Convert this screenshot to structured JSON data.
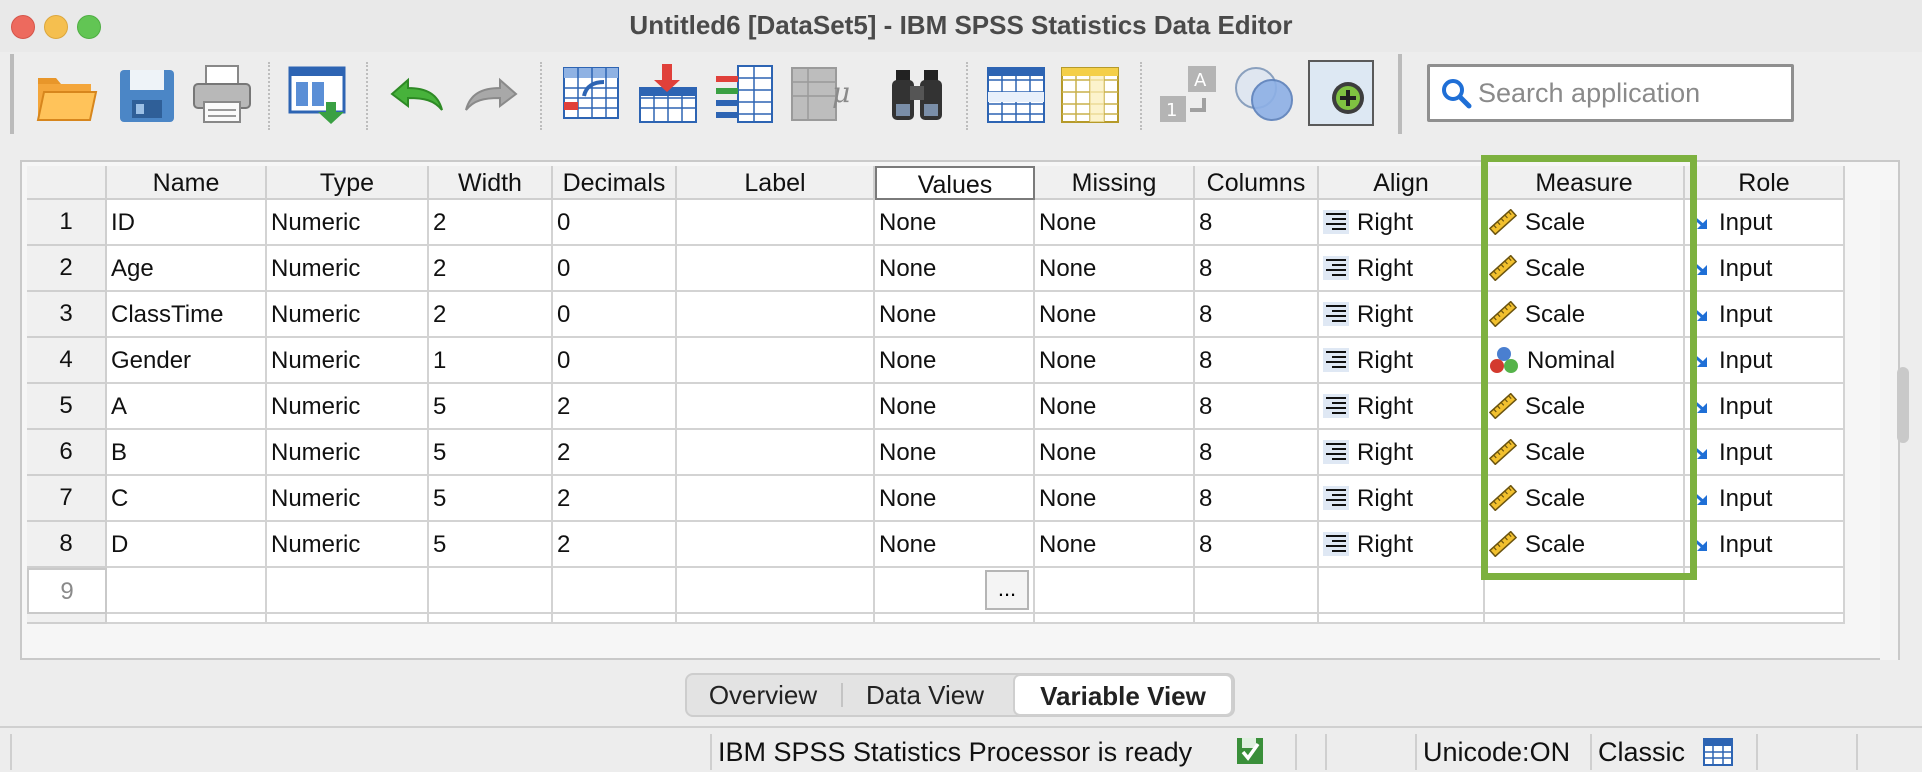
{
  "window": {
    "title": "Untitled6 [DataSet5] - IBM SPSS Statistics Data Editor"
  },
  "toolbar": {
    "icons": [
      "open-folder-icon",
      "save-icon",
      "print-icon",
      "recall-dialog-icon",
      "undo-icon",
      "redo-icon",
      "goto-case-icon",
      "goto-variable-icon",
      "variables-icon",
      "run-descriptives-icon",
      "find-icon",
      "insert-cases-icon",
      "insert-variable-icon",
      "split-file-icon",
      "select-cases-icon",
      "value-labels-icon",
      "use-variable-sets-icon"
    ],
    "search_placeholder": "Search application"
  },
  "grid": {
    "columns": [
      "Name",
      "Type",
      "Width",
      "Decimals",
      "Label",
      "Values",
      "Missing",
      "Columns",
      "Align",
      "Measure",
      "Role"
    ],
    "rows": [
      {
        "num": "1",
        "name": "ID",
        "type": "Numeric",
        "width": "2",
        "decimals": "0",
        "label": "",
        "values": "None",
        "missing": "None",
        "columns": "8",
        "align": "Right",
        "measure": "Scale",
        "role": "Input"
      },
      {
        "num": "2",
        "name": "Age",
        "type": "Numeric",
        "width": "2",
        "decimals": "0",
        "label": "",
        "values": "None",
        "missing": "None",
        "columns": "8",
        "align": "Right",
        "measure": "Scale",
        "role": "Input"
      },
      {
        "num": "3",
        "name": "ClassTime",
        "type": "Numeric",
        "width": "2",
        "decimals": "0",
        "label": "",
        "values": "None",
        "missing": "None",
        "columns": "8",
        "align": "Right",
        "measure": "Scale",
        "role": "Input"
      },
      {
        "num": "4",
        "name": "Gender",
        "type": "Numeric",
        "width": "1",
        "decimals": "0",
        "label": "",
        "values": "None",
        "missing": "None",
        "columns": "8",
        "align": "Right",
        "measure": "Nominal",
        "role": "Input"
      },
      {
        "num": "5",
        "name": "A",
        "type": "Numeric",
        "width": "5",
        "decimals": "2",
        "label": "",
        "values": "None",
        "missing": "None",
        "columns": "8",
        "align": "Right",
        "measure": "Scale",
        "role": "Input"
      },
      {
        "num": "6",
        "name": "B",
        "type": "Numeric",
        "width": "5",
        "decimals": "2",
        "label": "",
        "values": "None",
        "missing": "None",
        "columns": "8",
        "align": "Right",
        "measure": "Scale",
        "role": "Input"
      },
      {
        "num": "7",
        "name": "C",
        "type": "Numeric",
        "width": "5",
        "decimals": "2",
        "label": "",
        "values": "None",
        "missing": "None",
        "columns": "8",
        "align": "Right",
        "measure": "Scale",
        "role": "Input"
      },
      {
        "num": "8",
        "name": "D",
        "type": "Numeric",
        "width": "5",
        "decimals": "2",
        "label": "",
        "values": "None",
        "missing": "None",
        "columns": "8",
        "align": "Right",
        "measure": "Scale",
        "role": "Input"
      }
    ],
    "empty_row_num": "9",
    "ellipsis": "...",
    "highlight_color": "#7db13f"
  },
  "tabs": [
    {
      "label": "Overview",
      "active": false
    },
    {
      "label": "Data View",
      "active": false
    },
    {
      "label": "Variable View",
      "active": true
    }
  ],
  "status": {
    "processor": "IBM SPSS Statistics Processor is ready",
    "unicode": "Unicode:ON",
    "mode": "Classic"
  }
}
